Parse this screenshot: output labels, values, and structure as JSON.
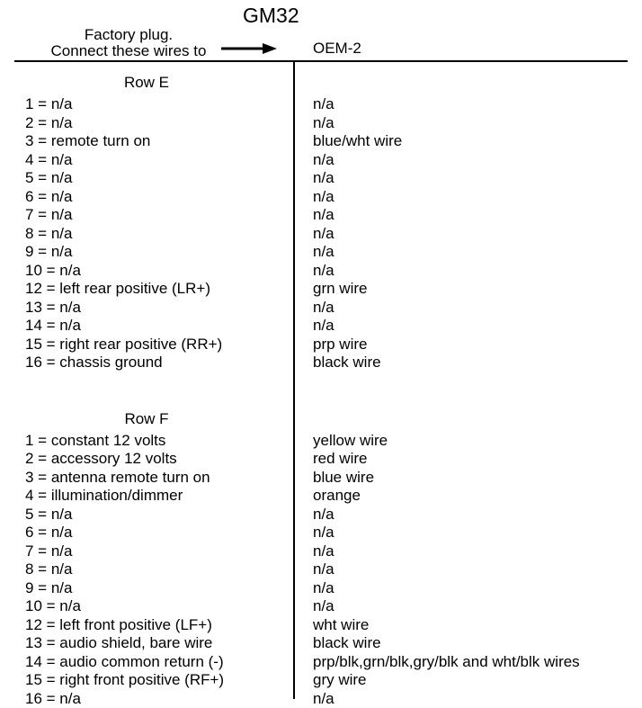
{
  "title": "GM32",
  "header": {
    "factory_line1": "Factory plug.",
    "factory_line2": "Connect these wires to",
    "oem_label": "OEM-2"
  },
  "chart_data": {
    "type": "table",
    "title": "GM32",
    "sections": [
      {
        "name": "Row E",
        "rows": [
          {
            "pin": "1",
            "desc": "n/a",
            "oem": "n/a"
          },
          {
            "pin": "2",
            "desc": "n/a",
            "oem": "n/a"
          },
          {
            "pin": "3",
            "desc": "remote turn on",
            "oem": "blue/wht wire"
          },
          {
            "pin": "4",
            "desc": "n/a",
            "oem": "n/a"
          },
          {
            "pin": "5",
            "desc": "n/a",
            "oem": "n/a"
          },
          {
            "pin": "6",
            "desc": "n/a",
            "oem": "n/a"
          },
          {
            "pin": "7",
            "desc": "n/a",
            "oem": "n/a"
          },
          {
            "pin": "8",
            "desc": "n/a",
            "oem": "n/a"
          },
          {
            "pin": "9",
            "desc": "n/a",
            "oem": "n/a"
          },
          {
            "pin": "10",
            "desc": "n/a",
            "oem": "n/a"
          },
          {
            "pin": "12",
            "desc": "left rear positive (LR+)",
            "oem": "grn wire"
          },
          {
            "pin": "13",
            "desc": "n/a",
            "oem": "n/a"
          },
          {
            "pin": "14",
            "desc": "n/a",
            "oem": "n/a"
          },
          {
            "pin": "15",
            "desc": "right rear positive (RR+)",
            "oem": "prp wire"
          },
          {
            "pin": "16",
            "desc": "chassis ground",
            "oem": "black wire"
          }
        ]
      },
      {
        "name": "Row F",
        "rows": [
          {
            "pin": "1",
            "desc": "constant 12 volts",
            "oem": "yellow wire"
          },
          {
            "pin": "2",
            "desc": "accessory 12 volts",
            "oem": "red wire"
          },
          {
            "pin": "3",
            "desc": "antenna remote turn on",
            "oem": "blue wire"
          },
          {
            "pin": "4",
            "desc": "illumination/dimmer",
            "oem": "orange"
          },
          {
            "pin": "5",
            "desc": "n/a",
            "oem": "n/a"
          },
          {
            "pin": "6",
            "desc": "n/a",
            "oem": "n/a"
          },
          {
            "pin": "7",
            "desc": "n/a",
            "oem": "n/a"
          },
          {
            "pin": "8",
            "desc": "n/a",
            "oem": "n/a"
          },
          {
            "pin": "9",
            "desc": "n/a",
            "oem": "n/a"
          },
          {
            "pin": "10",
            "desc": "n/a",
            "oem": "n/a"
          },
          {
            "pin": "12",
            "desc": "left front positive (LF+)",
            "oem": "wht wire"
          },
          {
            "pin": "13",
            "desc": "audio shield, bare wire",
            "oem": "black wire"
          },
          {
            "pin": "14",
            "desc": "audio common return (-)",
            "oem": "prp/blk,grn/blk,gry/blk and wht/blk wires"
          },
          {
            "pin": "15",
            "desc": "right front positive (RF+)",
            "oem": "gry wire"
          },
          {
            "pin": "16",
            "desc": "n/a",
            "oem": "n/a"
          }
        ]
      }
    ]
  }
}
